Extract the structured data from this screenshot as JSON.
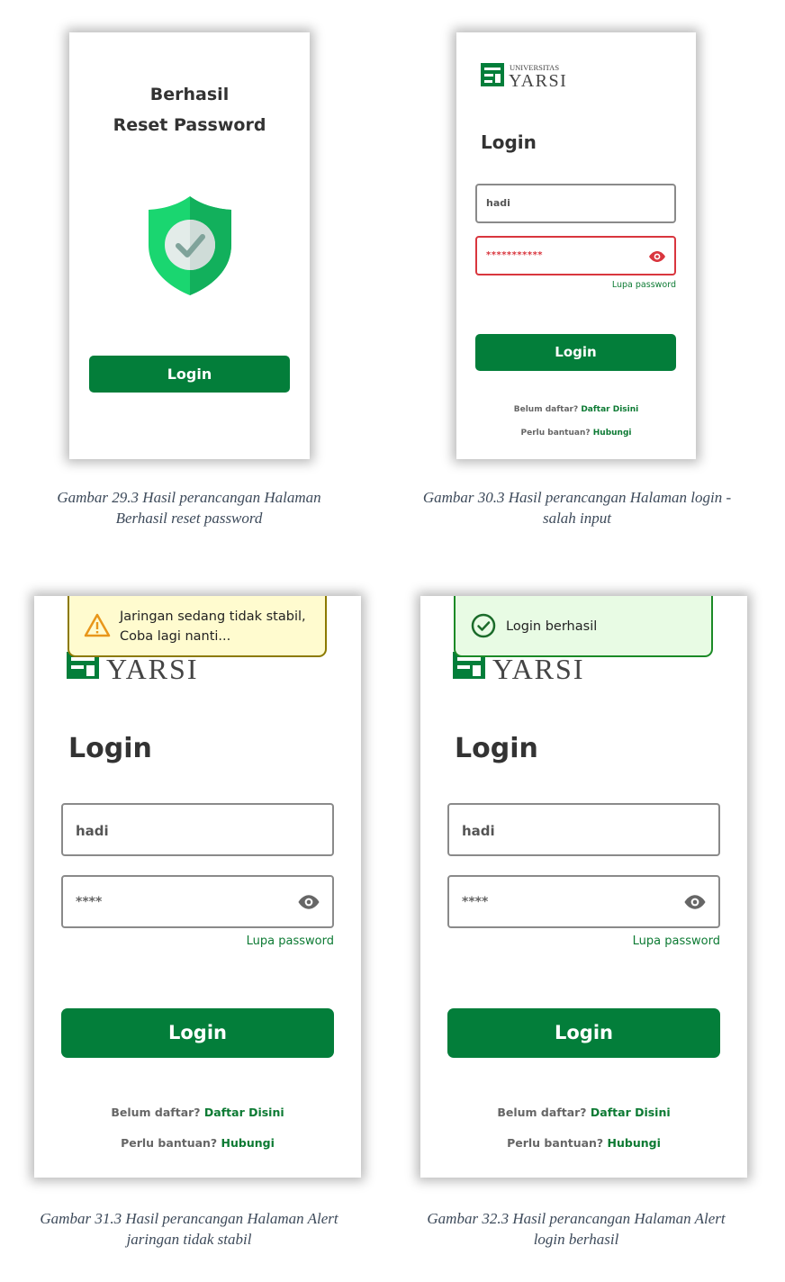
{
  "fig29": {
    "title_line1": "Berhasil",
    "title_line2": "Reset Password",
    "button": "Login",
    "caption_line1": "Gambar 29.3 Hasil perancangan Halaman",
    "caption_line2": "Berhasil reset password"
  },
  "fig30": {
    "logo_top": "UNIVERSITAS",
    "logo_name": "YARSI",
    "heading": "Login",
    "username": "hadi",
    "password": "***********",
    "forgot": "Lupa password",
    "button": "Login",
    "register_prompt": "Belum daftar?",
    "register_link": "Daftar Disini",
    "help_prompt": "Perlu bantuan?",
    "help_link": "Hubungi",
    "caption_line1": "Gambar 30.3 Hasil perancangan Halaman login -",
    "caption_line2": "salah input"
  },
  "fig31": {
    "alert_line1": "Jaringan sedang tidak stabil,",
    "alert_line2": "Coba lagi nanti...",
    "logo_name": "YARSI",
    "heading": "Login",
    "username": "hadi",
    "password": "****",
    "forgot": "Lupa password",
    "button": "Login",
    "register_prompt": "Belum daftar?",
    "register_link": "Daftar Disini",
    "help_prompt": "Perlu bantuan?",
    "help_link": "Hubungi",
    "caption_line1": "Gambar 31.3 Hasil perancangan Halaman Alert",
    "caption_line2": "jaringan tidak stabil"
  },
  "fig32": {
    "alert_text": "Login berhasil",
    "logo_name": "YARSI",
    "heading": "Login",
    "username": "hadi",
    "password": "****",
    "forgot": "Lupa password",
    "button": "Login",
    "register_prompt": "Belum daftar?",
    "register_link": "Daftar Disini",
    "help_prompt": "Perlu bantuan?",
    "help_link": "Hubungi",
    "caption_line1": "Gambar 32.3 Hasil perancangan Halaman Alert",
    "caption_line2": "login berhasil"
  },
  "colors": {
    "brand_green": "#037e3a",
    "link_green": "#0c7a33",
    "error_red": "#d9363e",
    "warn_bg": "#fffbcf",
    "success_bg": "#e8fbe4"
  },
  "icons": [
    "shield-check-icon",
    "eye-icon",
    "warning-icon",
    "check-circle-icon",
    "yarsi-logo"
  ]
}
